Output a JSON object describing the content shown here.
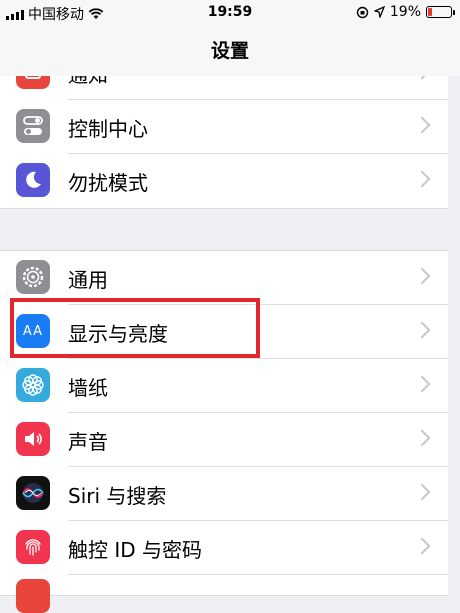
{
  "status": {
    "carrier": "中国移动",
    "time": "19:59",
    "battery_percent": 19,
    "battery_text": "19%"
  },
  "nav": {
    "title": "设置"
  },
  "groups": [
    {
      "items": [
        {
          "label": "通知",
          "icon": "notifications-icon"
        },
        {
          "label": "控制中心",
          "icon": "control-center-icon"
        },
        {
          "label": "勿扰模式",
          "icon": "moon-icon"
        }
      ]
    },
    {
      "items": [
        {
          "label": "通用",
          "icon": "gear-icon"
        },
        {
          "label": "显示与亮度",
          "icon": "display-brightness-icon",
          "icon_text": "AA"
        },
        {
          "label": "墙纸",
          "icon": "wallpaper-icon"
        },
        {
          "label": "声音",
          "icon": "sound-icon"
        },
        {
          "label": "Siri 与搜索",
          "icon": "siri-icon"
        },
        {
          "label": "触控 ID 与密码",
          "icon": "fingerprint-icon"
        }
      ]
    }
  ],
  "colors": {
    "notifications": "#e8453c",
    "control_center": "#8e8e93",
    "do_not_disturb": "#5856d6",
    "general": "#8e8e93",
    "display": "#1a7cf5",
    "wallpaper": "#35aadc",
    "sound": "#f2354f",
    "touch_id": "#f2354f",
    "highlight": "#e0292f"
  }
}
